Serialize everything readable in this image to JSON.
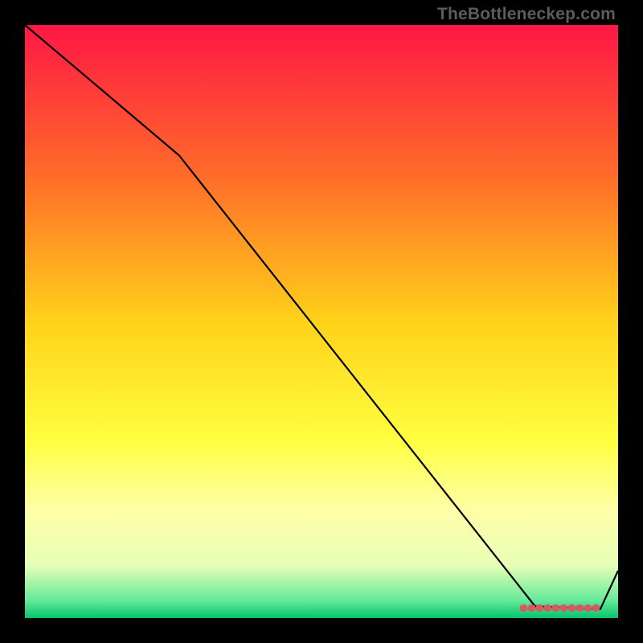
{
  "watermark": "TheBottleneckер.com",
  "chart_data": {
    "type": "line",
    "title": "",
    "xlabel": "",
    "ylabel": "",
    "xlim": [
      0,
      100
    ],
    "ylim": [
      0,
      100
    ],
    "background": {
      "type": "vertical-gradient",
      "stops": [
        {
          "y": 0,
          "color": "#ff1745"
        },
        {
          "y": 25,
          "color": "#ff6a2a"
        },
        {
          "y": 50,
          "color": "#ffd21a"
        },
        {
          "y": 70,
          "color": "#ffff40"
        },
        {
          "y": 82,
          "color": "#feffa8"
        },
        {
          "y": 91,
          "color": "#e8ffb8"
        },
        {
          "y": 97,
          "color": "#66ea9a"
        },
        {
          "y": 100,
          "color": "#07c36d"
        }
      ]
    },
    "series": [
      {
        "name": "black-line",
        "color": "#000000",
        "x": [
          0,
          26,
          86,
          97,
          100
        ],
        "y": [
          100,
          78,
          2,
          1.5,
          8
        ]
      },
      {
        "name": "flat-red-band",
        "color": "#d45a5f",
        "x": [
          84,
          97
        ],
        "y": [
          1.7,
          1.7
        ]
      }
    ]
  }
}
